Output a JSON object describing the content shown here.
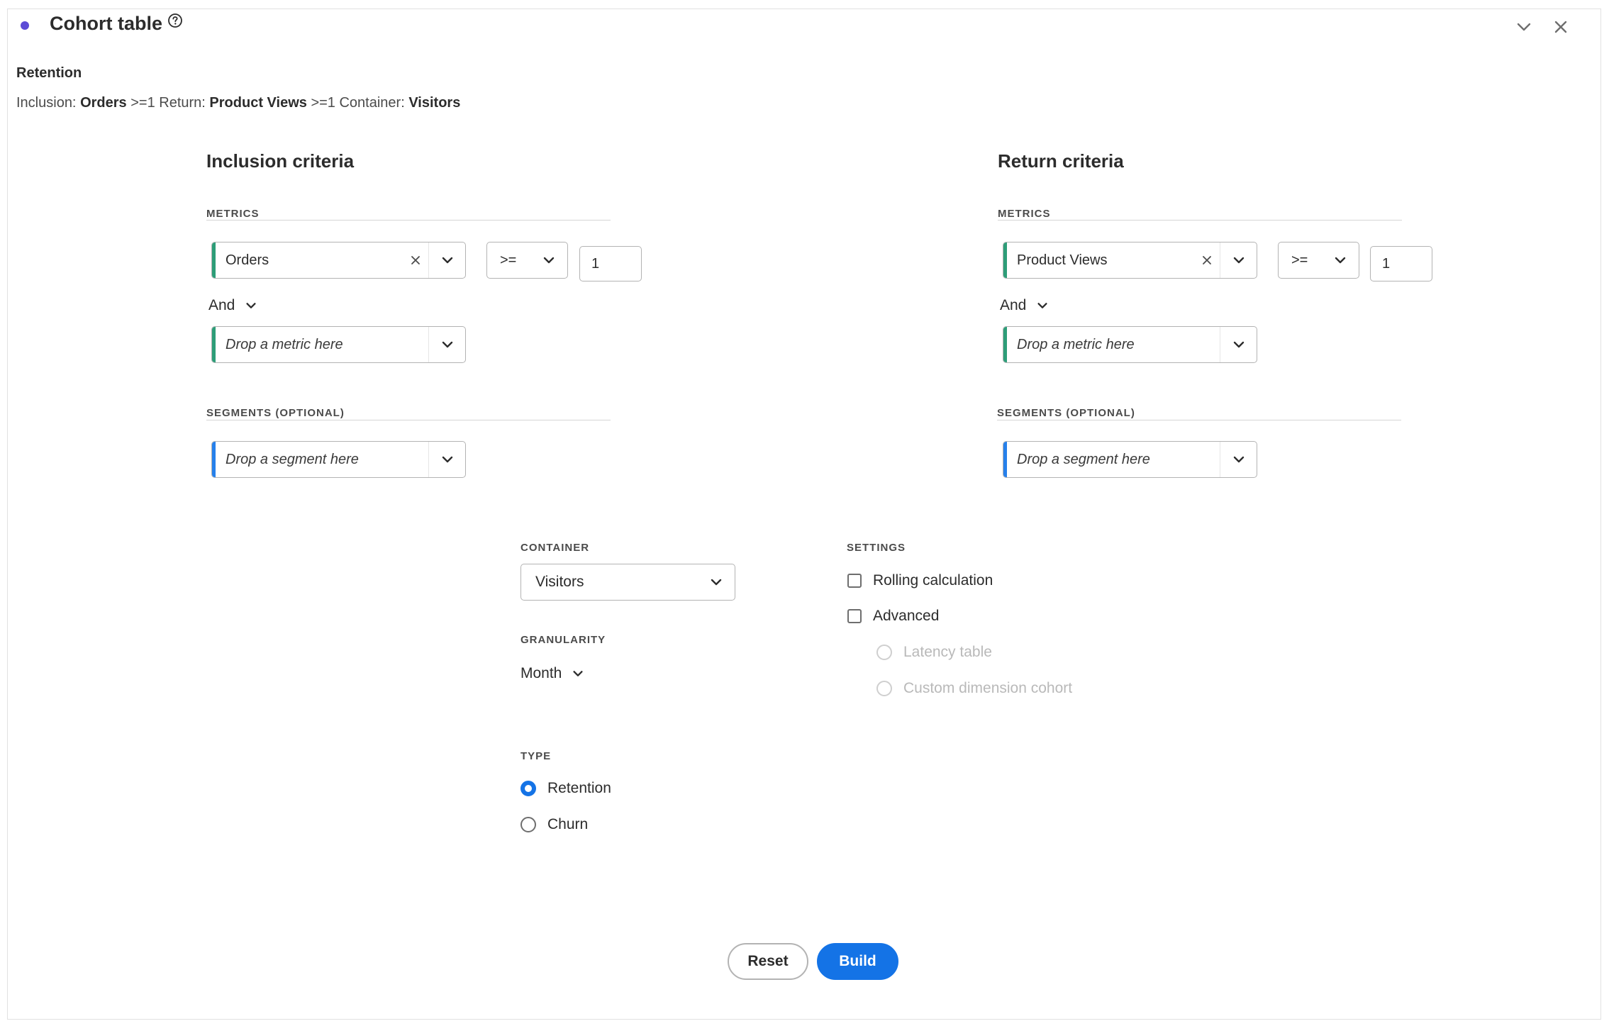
{
  "header": {
    "title": "Cohort table",
    "accent_color": "#5c4bd6"
  },
  "summary": {
    "type_label": "Retention",
    "inclusion_label": "Inclusion:",
    "inclusion_metric": "Orders",
    "inclusion_condition": ">=1",
    "return_label": "Return:",
    "return_metric": "Product Views",
    "return_condition": ">=1",
    "container_label": "Container:",
    "container_value": "Visitors"
  },
  "inclusion": {
    "title": "Inclusion criteria",
    "metrics_label": "METRICS",
    "metric": "Orders",
    "operator": ">=",
    "value": "1",
    "and_label": "And",
    "metric_placeholder": "Drop a metric here",
    "segments_label": "SEGMENTS (OPTIONAL)",
    "segment_placeholder": "Drop a segment here"
  },
  "return": {
    "title": "Return criteria",
    "metrics_label": "METRICS",
    "metric": "Product Views",
    "operator": ">=",
    "value": "1",
    "and_label": "And",
    "metric_placeholder": "Drop a metric here",
    "segments_label": "SEGMENTS (OPTIONAL)",
    "segment_placeholder": "Drop a segment here"
  },
  "container": {
    "label": "CONTAINER",
    "value": "Visitors"
  },
  "granularity": {
    "label": "GRANULARITY",
    "value": "Month"
  },
  "type": {
    "label": "TYPE",
    "options": [
      "Retention",
      "Churn"
    ],
    "selected": "Retention"
  },
  "settings": {
    "label": "SETTINGS",
    "rolling": "Rolling calculation",
    "advanced": "Advanced",
    "latency": "Latency table",
    "custom_dimension": "Custom dimension cohort"
  },
  "actions": {
    "reset": "Reset",
    "build": "Build"
  },
  "colors": {
    "metric_bar": "#2d9d78",
    "segment_bar": "#2680eb",
    "primary": "#1473e6"
  }
}
